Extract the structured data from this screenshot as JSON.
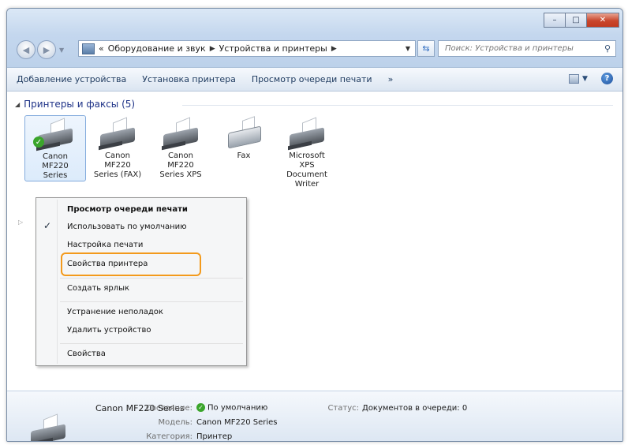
{
  "window": {
    "minimize_icon": "minimize-icon",
    "maximize_icon": "maximize-icon",
    "close_icon": "close-icon"
  },
  "address_bar": {
    "overflow": "«",
    "crumbs": [
      "Оборудование и звук",
      "Устройства и принтеры"
    ]
  },
  "search": {
    "placeholder": "Поиск: Устройства и принтеры"
  },
  "command_bar": {
    "items": [
      "Добавление устройства",
      "Установка принтера",
      "Просмотр очереди печати",
      "»"
    ]
  },
  "group": {
    "title": "Принтеры и факсы (5)"
  },
  "devices": [
    {
      "label_lines": [
        "Canon",
        "MF220",
        "Series"
      ],
      "icon": "printer-icon",
      "default": true,
      "selected": true
    },
    {
      "label_lines": [
        "Canon",
        "MF220",
        "Series (FAX)"
      ],
      "icon": "printer-icon",
      "default": false,
      "selected": false
    },
    {
      "label_lines": [
        "Canon",
        "MF220",
        "Series XPS"
      ],
      "icon": "printer-icon",
      "default": false,
      "selected": false
    },
    {
      "label_lines": [
        "Fax"
      ],
      "icon": "fax-icon",
      "default": false,
      "selected": false
    },
    {
      "label_lines": [
        "Microsoft",
        "XPS",
        "Document",
        "Writer"
      ],
      "icon": "printer-icon",
      "default": false,
      "selected": false
    }
  ],
  "context_menu": {
    "items": [
      {
        "label": "Просмотр очереди печати",
        "bold": true,
        "checked": false
      },
      {
        "label": "Использовать по умолчанию",
        "bold": false,
        "checked": true
      },
      {
        "label": "Настройка печати",
        "bold": false,
        "checked": false
      },
      {
        "label": "Свойства принтера",
        "bold": false,
        "checked": false,
        "highlighted": true
      },
      {
        "label": "Создать ярлык",
        "bold": false,
        "checked": false
      },
      {
        "label": "Устранение неполадок",
        "bold": false,
        "checked": false
      },
      {
        "label": "Удалить устройство",
        "bold": false,
        "checked": false
      },
      {
        "label": "Свойства",
        "bold": false,
        "checked": false
      }
    ],
    "highlight_color": "#f39a1c"
  },
  "details": {
    "name": "Canon MF220 Series",
    "state_label": "Состояние:",
    "state_value": "По умолчанию",
    "status_label": "Статус:",
    "status_value": "Документов в очереди: 0",
    "model_label": "Модель:",
    "model_value": "Canon MF220 Series",
    "category_label": "Категория:",
    "category_value": "Принтер"
  },
  "colors": {
    "accent": "#1e3287",
    "selection_border": "#84acdd",
    "default_check": "#3aa52b"
  }
}
